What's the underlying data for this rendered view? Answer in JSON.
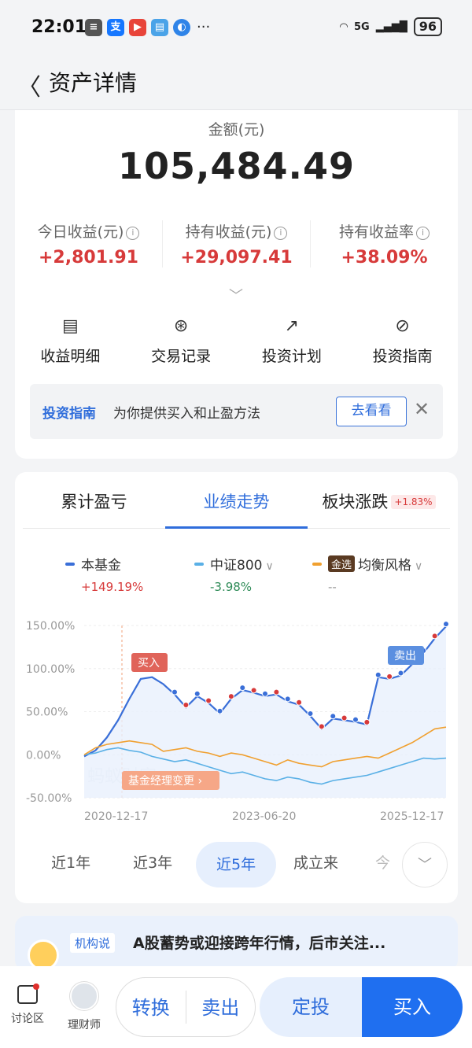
{
  "status": {
    "time": "22:01",
    "battery": "96",
    "network": "5G"
  },
  "nav": {
    "title": "资产详情"
  },
  "summary": {
    "amount_label": "金额(元)",
    "amount": "105,484.49",
    "stats": [
      {
        "label": "今日收益(元)",
        "value": "+2,801.91"
      },
      {
        "label": "持有收益(元)",
        "value": "+29,097.41"
      },
      {
        "label": "持有收益率",
        "value": "+38.09%"
      }
    ]
  },
  "actions": [
    {
      "label": "收益明细",
      "icon": "document-icon"
    },
    {
      "label": "交易记录",
      "icon": "yen-icon"
    },
    {
      "label": "投资计划",
      "icon": "trend-icon"
    },
    {
      "label": "投资指南",
      "icon": "compass-icon"
    }
  ],
  "guide": {
    "tag": "投资指南",
    "text": "为你提供买入和止盈方法",
    "button": "去看看"
  },
  "tabs": [
    {
      "label": "累计盈亏"
    },
    {
      "label": "业绩走势"
    },
    {
      "label": "板块涨跌",
      "badge": "+1.83%"
    }
  ],
  "legend": [
    {
      "name": "本基金",
      "value": "+149.19%",
      "color": "#3a6fd8",
      "value_color": "#d73a3a"
    },
    {
      "name": "中证800",
      "value": "-3.98%",
      "color": "#5ab0e6",
      "value_color": "#2e8b57"
    },
    {
      "name": "均衡风格",
      "badge": "金选",
      "value": "--",
      "color": "#f0a030",
      "value_color": "#999999"
    }
  ],
  "chart_data": {
    "type": "line",
    "x_ticks": [
      "2020-12-17",
      "2023-06-20",
      "2025-12-17"
    ],
    "y_ticks": [
      "150.00%",
      "100.00%",
      "50.00%",
      "0.00%",
      "-50.00%"
    ],
    "ylim": [
      -50,
      150
    ],
    "annotations": {
      "buy": "买入",
      "sell": "卖出",
      "manager_change": "基金经理变更",
      "watermark": "蚂蚁财富"
    },
    "series": [
      {
        "name": "本基金",
        "color": "#3a6fd8",
        "values": [
          -2,
          5,
          20,
          40,
          65,
          88,
          90,
          82,
          70,
          55,
          68,
          60,
          48,
          65,
          75,
          72,
          68,
          70,
          62,
          58,
          45,
          30,
          42,
          40,
          38,
          35,
          90,
          88,
          92,
          105,
          118,
          135,
          149
        ]
      },
      {
        "name": "中证800",
        "color": "#5ab0e6",
        "values": [
          0,
          2,
          6,
          8,
          5,
          3,
          -2,
          -5,
          -8,
          -6,
          -10,
          -14,
          -18,
          -22,
          -20,
          -24,
          -28,
          -30,
          -26,
          -28,
          -32,
          -34,
          -30,
          -28,
          -26,
          -24,
          -20,
          -16,
          -12,
          -8,
          -4,
          -5,
          -4
        ]
      },
      {
        "name": "均衡风格",
        "color": "#f0a030",
        "values": [
          0,
          8,
          12,
          14,
          16,
          14,
          12,
          4,
          6,
          8,
          4,
          2,
          -2,
          2,
          0,
          -4,
          -8,
          -12,
          -6,
          -10,
          -12,
          -14,
          -8,
          -6,
          -4,
          -2,
          -4,
          2,
          8,
          14,
          22,
          30,
          32
        ]
      }
    ]
  },
  "periods": [
    "近1年",
    "近3年",
    "近5年",
    "成立来",
    "今"
  ],
  "active_period": "近5年",
  "institution": {
    "tag": "机构说",
    "text": "A股蓄势或迎接跨年行情，后市关注..."
  },
  "bottom": {
    "forum": "讨论区",
    "advisor": "理财师",
    "convert": "转换",
    "sell": "卖出",
    "auto_invest": "定投",
    "buy": "买入"
  }
}
